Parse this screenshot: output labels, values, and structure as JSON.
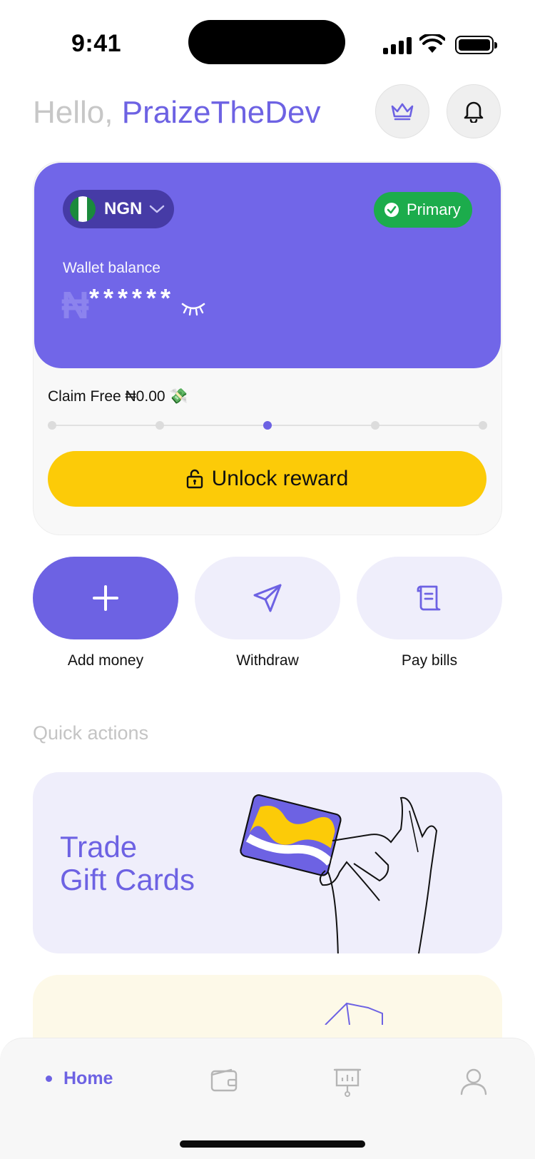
{
  "status_bar": {
    "time": "9:41"
  },
  "header": {
    "greeting_prefix": "Hello,",
    "user_name": "PraizeTheDev",
    "crown_icon": "crown-icon",
    "bell_icon": "bell-icon"
  },
  "wallet": {
    "currency_code": "NGN",
    "flag": "nigeria-flag",
    "badge_label": "Primary",
    "balance_label": "Wallet balance",
    "currency_symbol": "₦",
    "masked_balance": "******",
    "claim_text": "Claim Free ₦0.00 💸",
    "progress_steps": 5,
    "progress_active_step": 3,
    "unlock_label": "Unlock reward"
  },
  "actions": [
    {
      "label": "Add money",
      "icon": "plus-icon"
    },
    {
      "label": "Withdraw",
      "icon": "send-icon"
    },
    {
      "label": "Pay bills",
      "icon": "receipt-icon"
    }
  ],
  "quick_actions": {
    "title": "Quick actions",
    "gift_card_title_line1": "Trade",
    "gift_card_title_line2": "Gift Cards"
  },
  "bottom_nav": {
    "items": [
      {
        "label": "Home",
        "icon": "home-dot-icon",
        "active": true
      },
      {
        "label": "",
        "icon": "wallet-icon",
        "active": false
      },
      {
        "label": "",
        "icon": "presentation-chart-icon",
        "active": false
      },
      {
        "label": "",
        "icon": "profile-icon",
        "active": false
      }
    ]
  },
  "colors": {
    "accent": "#6d62e3",
    "card": "#7166e8",
    "badge_green": "#1cac4c",
    "unlock_yellow": "#fccb08",
    "soft_lavender": "#efeefb"
  }
}
